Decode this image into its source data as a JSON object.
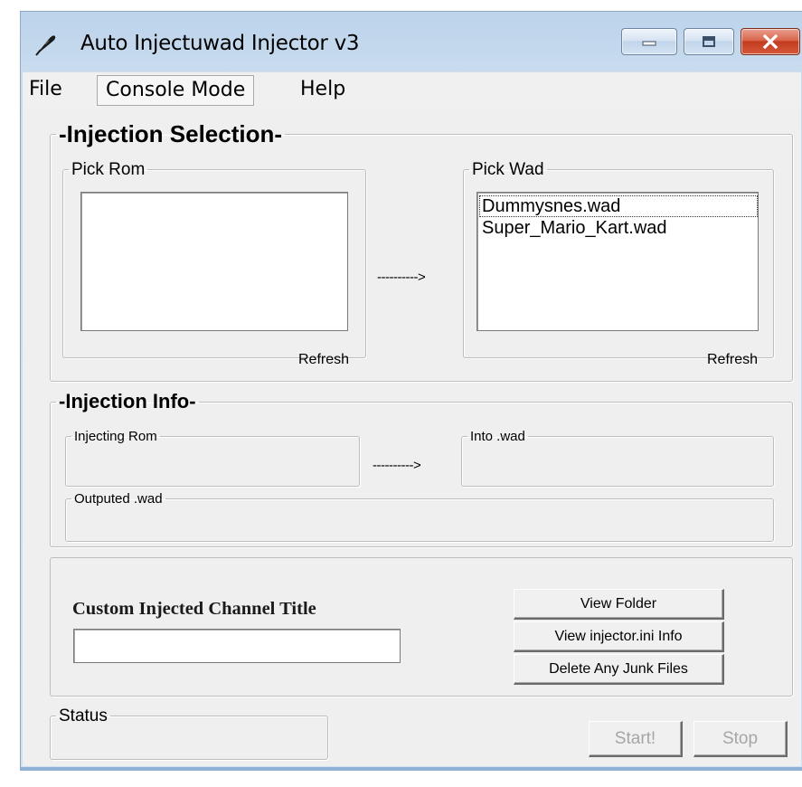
{
  "window": {
    "title": "Auto Injectuwad Injector v3"
  },
  "menu": {
    "items": [
      "File",
      "Console Mode",
      "Help"
    ]
  },
  "injection_selection": {
    "heading": "-Injection Selection-",
    "pick_rom": {
      "label": "Pick Rom",
      "items": [],
      "refresh_label": "Refresh"
    },
    "arrow": "---------->",
    "pick_wad": {
      "label": "Pick Wad",
      "items": [
        "Dummysnes.wad",
        "Super_Mario_Kart.wad"
      ],
      "refresh_label": "Refresh"
    }
  },
  "injection_info": {
    "heading": "-Injection Info-",
    "injecting_rom_label": "Injecting Rom",
    "injecting_rom_value": "",
    "arrow": "---------->",
    "into_wad_label": "Into .wad",
    "into_wad_value": "",
    "outputed_wad_label": "Outputed .wad",
    "outputed_wad_value": ""
  },
  "custom": {
    "title_label": "Custom Injected Channel Title",
    "title_value": ""
  },
  "buttons": {
    "view_folder": "View Folder",
    "view_ini": "View injector.ini Info",
    "delete_junk": "Delete Any Junk Files",
    "start": "Start!",
    "stop": "Stop"
  },
  "status": {
    "label": "Status",
    "value": ""
  },
  "colors": {
    "titlebar": "#c9dcef",
    "client_bg": "#efefef",
    "close_button": "#c23c1f",
    "disabled_text": "#a6a6a6"
  }
}
